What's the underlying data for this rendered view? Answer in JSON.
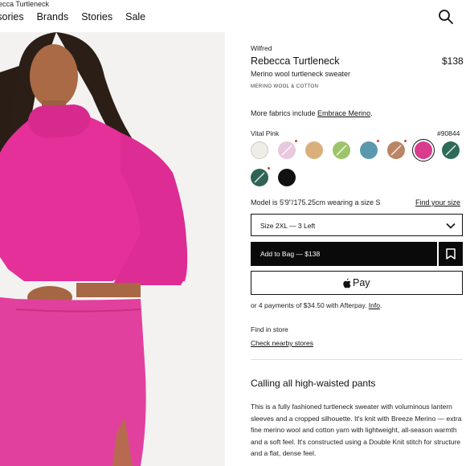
{
  "browser": {
    "tab_title": "ecca Turtleneck"
  },
  "nav": {
    "items": [
      "ssories",
      "Brands",
      "Stories",
      "Sale"
    ]
  },
  "product": {
    "brand": "Wilfred",
    "name": "Rebecca Turtleneck",
    "price": "$138",
    "subtitle": "Merino wool turtleneck sweater",
    "material_tag": "MERINO WOOL & COTTON",
    "fabrics_prefix": "More fabrics include ",
    "fabrics_link": "Embrace Merino",
    "fabrics_suffix": ".",
    "color_name": "Vital Pink",
    "color_code": "#90844",
    "swatches": [
      {
        "color": "#efede7",
        "striped": false,
        "dot": false,
        "selected": false
      },
      {
        "color": "#e8c8de",
        "striped": true,
        "dot": true,
        "selected": false
      },
      {
        "color": "#d9b07c",
        "striped": false,
        "dot": false,
        "selected": false
      },
      {
        "color": "#9ec46a",
        "striped": true,
        "dot": false,
        "selected": false
      },
      {
        "color": "#5b98ad",
        "striped": false,
        "dot": true,
        "selected": false
      },
      {
        "color": "#b98566",
        "striped": true,
        "dot": true,
        "selected": false
      },
      {
        "color": "#d93b8e",
        "striped": false,
        "dot": false,
        "selected": true
      },
      {
        "color": "#2e6a58",
        "striped": true,
        "dot": false,
        "selected": false
      },
      {
        "color": "#2f6356",
        "striped": true,
        "dot": true,
        "selected": false
      },
      {
        "color": "#111111",
        "striped": false,
        "dot": false,
        "selected": false
      }
    ],
    "model_info": "Model is 5'9\"/175.25cm wearing a size S",
    "find_size": "Find your size",
    "size_selected": "Size 2XL — 3 Left",
    "add_to_bag": "Add to Bag — $138",
    "apple_pay": "Pay",
    "afterpay_text": "or 4 payments of $34.50 with Afterpay. ",
    "afterpay_link": "Info",
    "afterpay_suffix": ".",
    "find_in_store": "Find in store",
    "check_stores": "Check nearby stores",
    "section_heading": "Calling all high-waisted pants",
    "description": "This is a fully fashioned turtleneck sweater with voluminous lantern sleeves and a cropped silhouette. It's knit with Breeze Merino — extra fine merino wool and cotton yarn with lightweight, all-season warmth and a soft feel. It's constructed using a Double Knit stitch for structure and a flat, dense feel."
  },
  "colors": {
    "sweater": "#e5309a",
    "skirt": "#e2409e",
    "text": "#111111",
    "button": "#0a0a0a"
  },
  "icons": {
    "search": "search-icon",
    "chevron": "chevron-down-icon",
    "bookmark": "bookmark-icon",
    "apple": "apple-logo-icon"
  }
}
